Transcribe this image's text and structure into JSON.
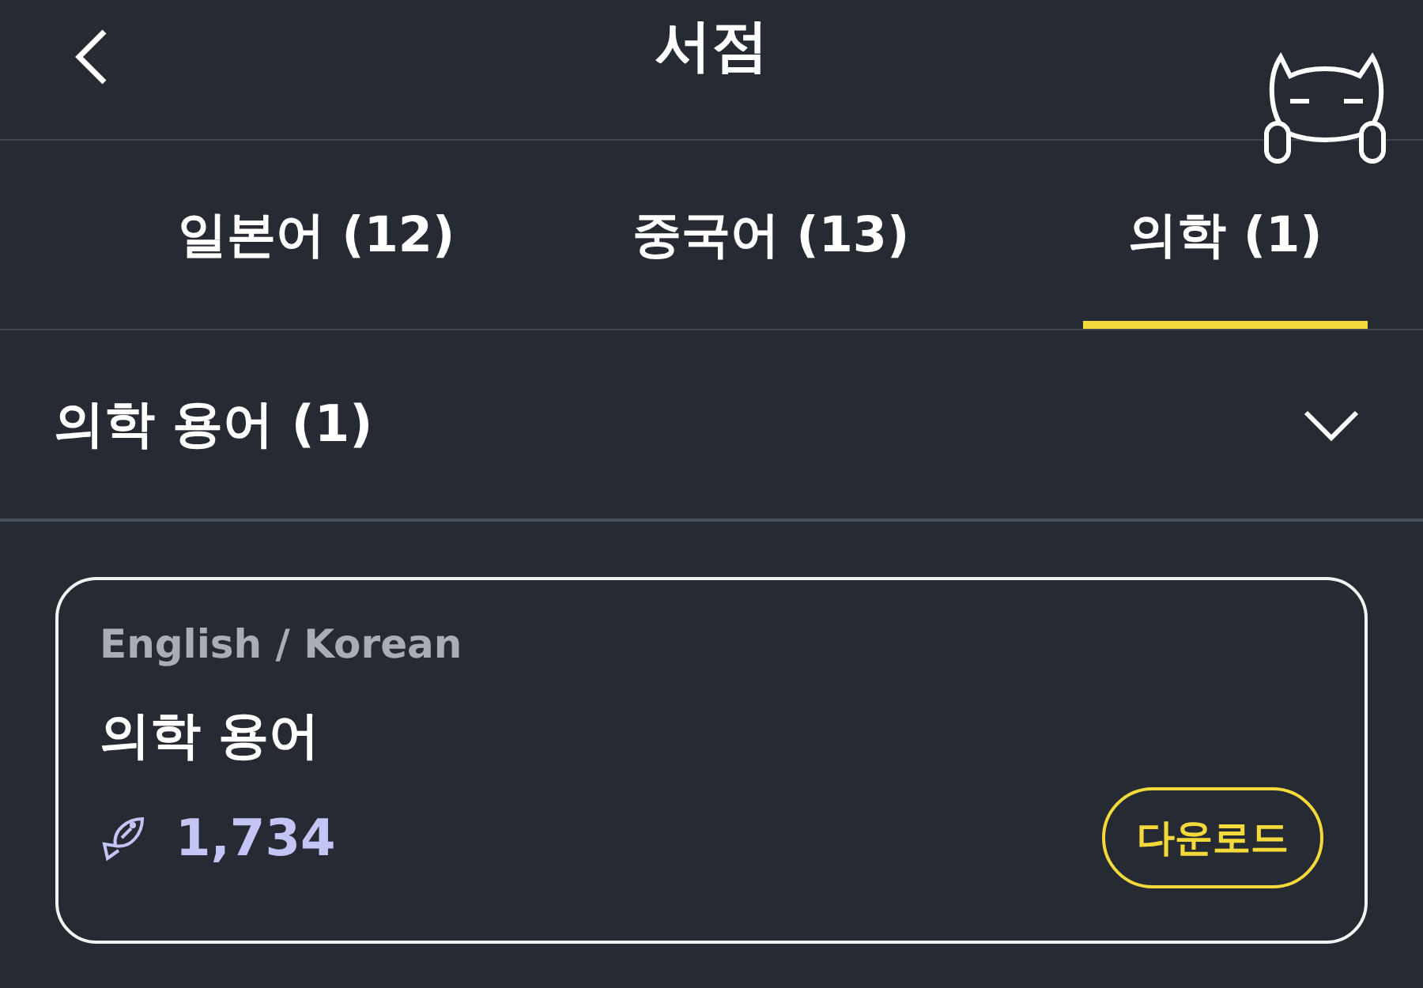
{
  "header": {
    "title": "서점"
  },
  "tabs": [
    {
      "label": "일본어 (12)",
      "selected": false
    },
    {
      "label": "중국어 (13)",
      "selected": false
    },
    {
      "label": "의학 (1)",
      "selected": true
    }
  ],
  "section": {
    "title": "의학 용어 (1)",
    "expanded": true
  },
  "books": [
    {
      "languages": "English / Korean",
      "title": "의학 용어",
      "count": "1,734",
      "button": "다운로드"
    }
  ]
}
